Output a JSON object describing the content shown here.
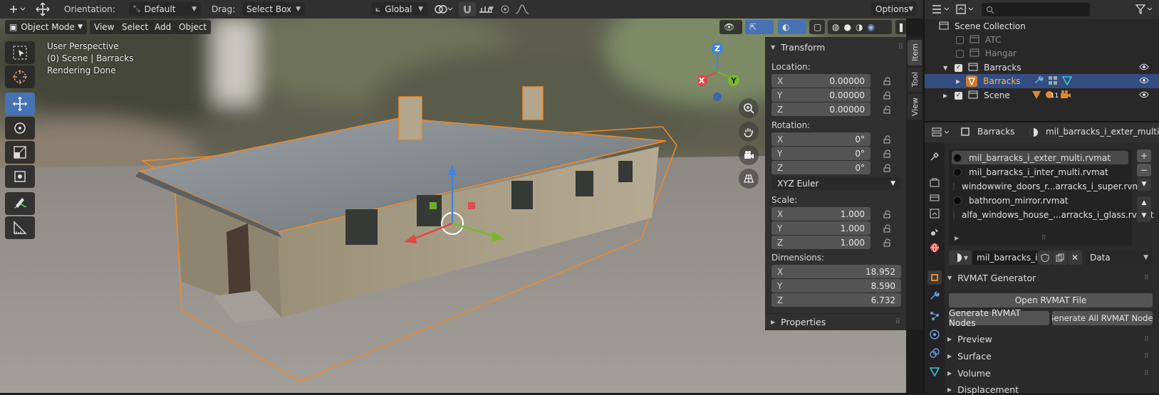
{
  "header": {
    "orientation_label": "Orientation:",
    "orientation_value": "Default",
    "drag_label": "Drag:",
    "drag_value": "Select Box",
    "transform_space": "Global",
    "options_label": "Options"
  },
  "viewport_header": {
    "mode": "Object Mode",
    "menus": [
      "View",
      "Select",
      "Add",
      "Object"
    ]
  },
  "viewport": {
    "info_line1": "User Perspective",
    "info_line2": "(0) Scene | Barracks",
    "info_line3": "Rendering Done",
    "gizmo_axes": {
      "x": "X",
      "y": "Y",
      "z": "Z"
    }
  },
  "npanel": {
    "tabs": [
      "Item",
      "Tool",
      "View"
    ],
    "transform_title": "Transform",
    "location_label": "Location:",
    "location": [
      {
        "axis": "X",
        "value": "0.00000"
      },
      {
        "axis": "Y",
        "value": "0.00000"
      },
      {
        "axis": "Z",
        "value": "0.00000"
      }
    ],
    "rotation_label": "Rotation:",
    "rotation": [
      {
        "axis": "X",
        "value": "0°"
      },
      {
        "axis": "Y",
        "value": "0°"
      },
      {
        "axis": "Z",
        "value": "0°"
      }
    ],
    "rotation_mode": "XYZ Euler",
    "scale_label": "Scale:",
    "scale": [
      {
        "axis": "X",
        "value": "1.000"
      },
      {
        "axis": "Y",
        "value": "1.000"
      },
      {
        "axis": "Z",
        "value": "1.000"
      }
    ],
    "dimensions_label": "Dimensions:",
    "dimensions": [
      {
        "axis": "X",
        "value": "18.952"
      },
      {
        "axis": "Y",
        "value": "8.590"
      },
      {
        "axis": "Z",
        "value": "6.732"
      }
    ],
    "properties_title": "Properties"
  },
  "outliner": {
    "root": "Scene Collection",
    "items": [
      {
        "label": "ATC"
      },
      {
        "label": "Hangar"
      },
      {
        "label": "Barracks"
      },
      {
        "label": "Barracks"
      },
      {
        "label": "Scene"
      }
    ],
    "scene_badge": "11"
  },
  "properties": {
    "object_name": "Barracks",
    "material_name": "mil_barracks_i_exter_multi.rvmat",
    "material_slots": [
      "mil_barracks_i_exter_multi.rvmat",
      "mil_barracks_i_inter_multi.rvmat",
      "windowwire_doors_r...arracks_i_super.rvmat",
      "bathroom_mirror.rvmat",
      "alfa_windows_house_...arracks_i_glass.rvmat"
    ],
    "material_field": "mil_barracks_i...",
    "link_mode": "Data",
    "rvmat_title": "RVMAT Generator",
    "open_rvmat": "Open RVMAT File",
    "gen_nodes": "Generate RVMAT Nodes",
    "gen_all": "Generate All RVMAT Nodes",
    "sections": [
      "Preview",
      "Surface",
      "Volume",
      "Displacement"
    ]
  },
  "colors": {
    "accent_blue": "#4772b3",
    "selection_orange": "#f08a24",
    "axis_x": "#e0464c",
    "axis_y": "#7ab82a",
    "axis_z": "#3f82e0"
  }
}
